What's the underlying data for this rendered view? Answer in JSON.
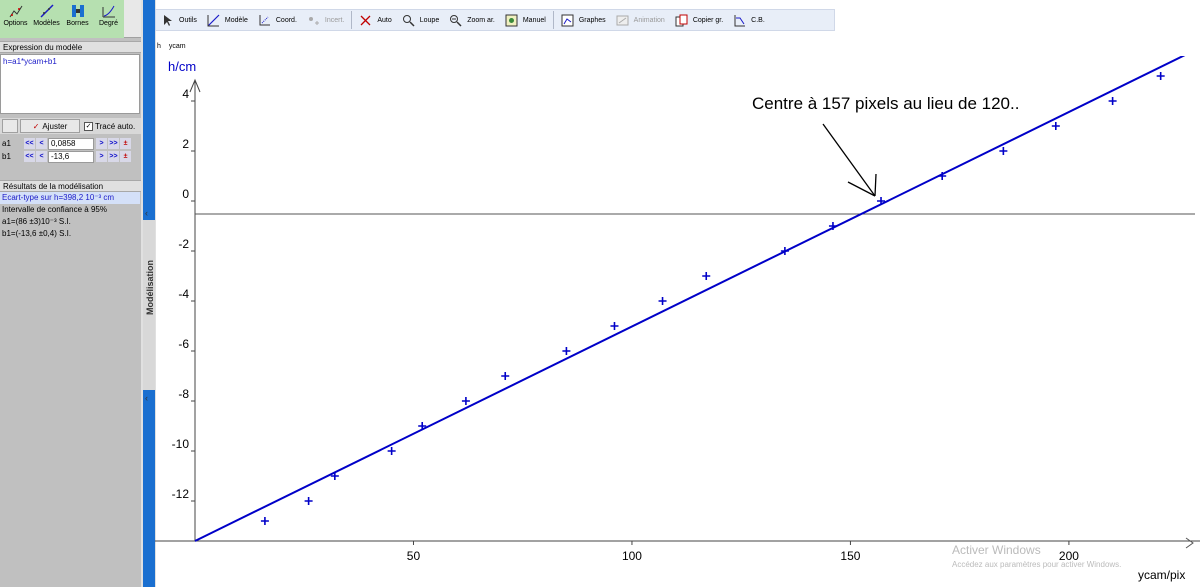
{
  "left_toolbar": {
    "options_label": "Options",
    "models_label": "Modèles",
    "bounds_label": "Bornes",
    "degree_label": "Degré"
  },
  "model_panel": {
    "title": "Expression du modèle",
    "expression": "h=a1*ycam+b1"
  },
  "fit_controls": {
    "fit_label": "Ajuster",
    "auto_trace_label": "Tracé auto.",
    "auto_trace_checked": true
  },
  "params": [
    {
      "name": "a1",
      "value": "0,0858"
    },
    {
      "name": "b1",
      "value": "-13,6"
    }
  ],
  "results": {
    "title": "Résultats de la modélisation",
    "line1": "Ecart-type sur h=398,2 10⁻³ cm",
    "line2": "Intervalle de confiance à 95%",
    "line3": "a1=(86 ±3)10⁻³ S.I.",
    "line4": "b1=(-13,6 ±0,4) S.I."
  },
  "splitter_label": "Modélisation",
  "toolbar": {
    "tools": "Outils",
    "model": "Modèle",
    "coord": "Coord.",
    "uncert": "Incert.",
    "auto": "Auto",
    "zoom": "Loupe",
    "zoom_back": "Zoom ar.",
    "manual": "Manuel",
    "graphs": "Graphes",
    "animation": "Animation",
    "copy": "Copier gr.",
    "cb": "C.B."
  },
  "sub_labels": [
    "h",
    "ycam"
  ],
  "watermark": {
    "line1": "Activer Windows",
    "line2": "Accédez aux paramètres pour activer Windows."
  },
  "colors": {
    "data": "#0000c8",
    "fit": "#0000c8",
    "accent": "#1a6fd0"
  },
  "chart_data": {
    "type": "scatter",
    "ylabel": "h/cm",
    "xlabel": "ycam/pix",
    "xlim": [
      0,
      230
    ],
    "ylim": [
      -13.6,
      5.8
    ],
    "xticks": [
      50,
      100,
      150,
      200
    ],
    "yticks": [
      -12,
      -10,
      -8,
      -6,
      -4,
      -2,
      0,
      2,
      4
    ],
    "x": [
      16,
      26,
      32,
      45,
      52,
      62,
      71,
      85,
      96,
      107,
      117,
      135,
      146,
      157,
      171,
      185,
      197,
      210,
      221
    ],
    "y": [
      -12.8,
      -12,
      -11,
      -10,
      -9,
      -8,
      -7,
      -6,
      -5,
      -4,
      -3,
      -2,
      -1,
      0,
      1,
      2,
      3,
      4,
      5
    ],
    "fit": {
      "a1": 0.0858,
      "b1": -13.6
    },
    "annotation": "Centre à 157 pixels au lieu de 120..",
    "annotation_target": {
      "x": 157,
      "y": 0.6
    }
  }
}
